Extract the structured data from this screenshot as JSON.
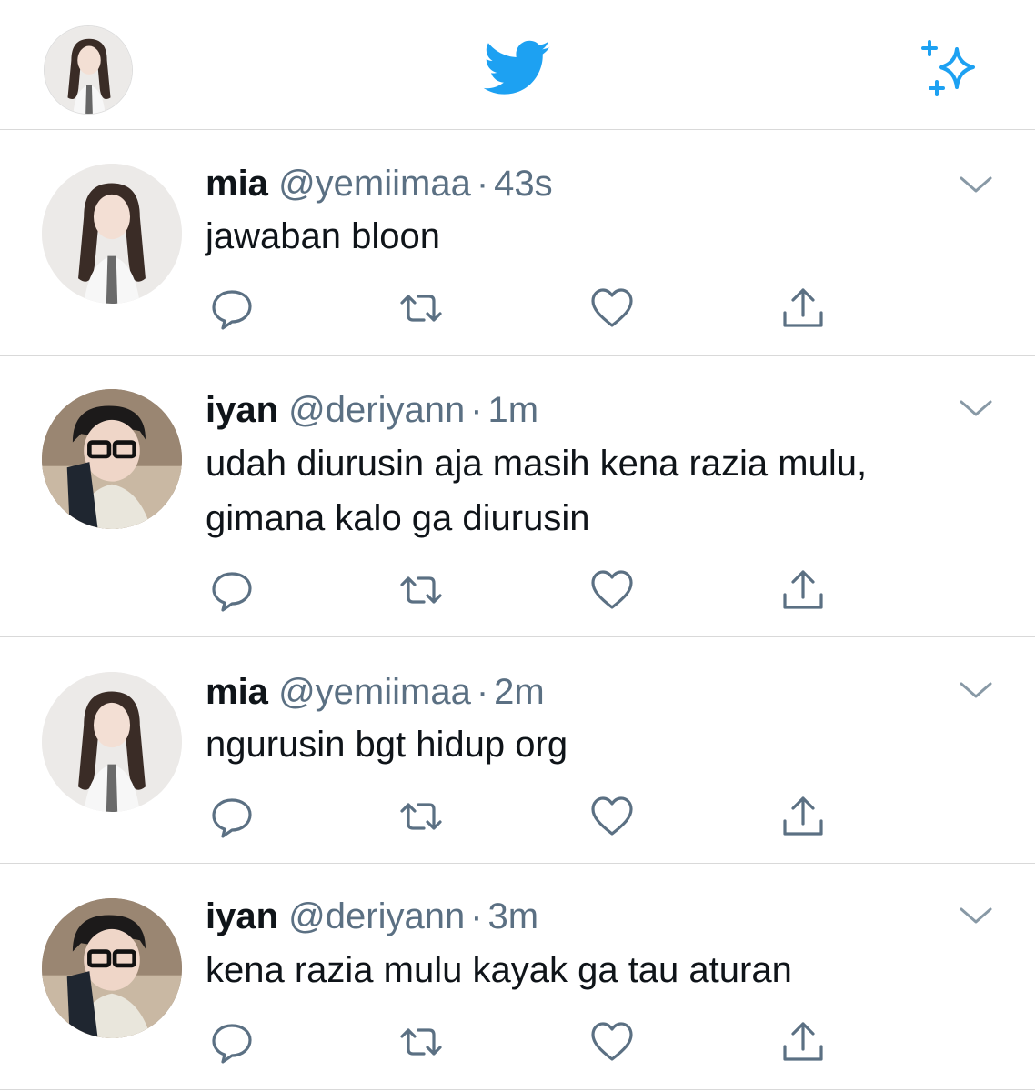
{
  "header": {
    "logo_icon": "twitter-bird-icon",
    "sparkle_icon": "sparkle-icon",
    "accent": "#1da1f2"
  },
  "tweets": [
    {
      "name": "mia",
      "handle": "@yemiimaa",
      "time": "43s",
      "lines": [
        "jawaban bloon"
      ]
    },
    {
      "name": "iyan",
      "handle": "@deriyann",
      "time": "1m",
      "lines": [
        "udah diurusin aja masih kena razia mulu,",
        "gimana kalo ga diurusin"
      ]
    },
    {
      "name": "mia",
      "handle": "@yemiimaa",
      "time": "2m",
      "lines": [
        "ngurusin bgt hidup org"
      ]
    },
    {
      "name": "iyan",
      "handle": "@deriyann",
      "time": "3m",
      "lines": [
        "kena razia mulu kayak ga tau aturan"
      ]
    }
  ],
  "separator": "·",
  "action_icons": [
    "reply-icon",
    "retweet-icon",
    "like-icon",
    "share-icon"
  ],
  "colors": {
    "text": "#0f1419",
    "secondary": "#5b7083",
    "divider": "#d9d9d9"
  }
}
